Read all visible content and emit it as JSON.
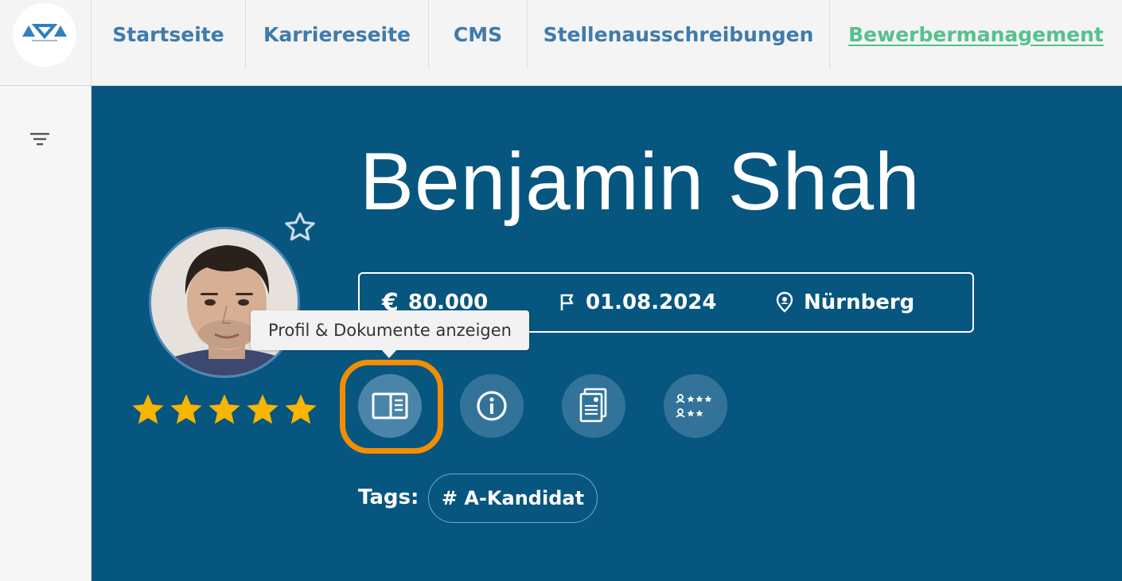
{
  "nav": {
    "items": [
      {
        "label": "Startseite",
        "active": false
      },
      {
        "label": "Karriereseite",
        "active": false
      },
      {
        "label": "CMS",
        "active": false
      },
      {
        "label": "Stellenausschreibungen",
        "active": false
      },
      {
        "label": "Bewerbermanagement",
        "active": true
      }
    ]
  },
  "candidate": {
    "name": "Benjamin Shah",
    "salary_symbol": "€",
    "salary": "80.000",
    "start_date": "01.08.2024",
    "location": "Nürnberg",
    "rating": 5,
    "rating_max": 5
  },
  "tooltip": {
    "text": "Profil & Dokumente anzeigen"
  },
  "actions": [
    {
      "name": "profile-documents",
      "icon": "id-card-icon"
    },
    {
      "name": "info",
      "icon": "info-icon"
    },
    {
      "name": "documents",
      "icon": "documents-icon"
    },
    {
      "name": "ratings",
      "icon": "user-ratings-icon"
    }
  ],
  "tags": {
    "label": "Tags:",
    "items": [
      "# A-Kandidat"
    ]
  },
  "colors": {
    "panel": "#075680",
    "nav_text": "#3f7bab",
    "nav_active": "#57c08e",
    "star": "#f7b500",
    "highlight": "#f28e00"
  }
}
